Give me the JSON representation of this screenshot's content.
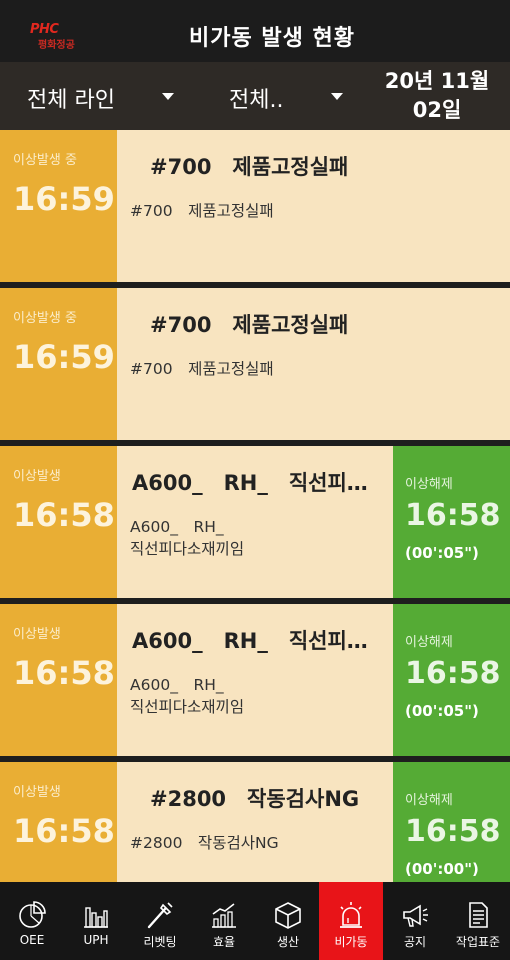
{
  "header": {
    "logo_mark": "PHC",
    "logo_text": "평화정공",
    "title": "비가동 발생 현황"
  },
  "filters": {
    "line": "전체 라인",
    "type": "전체..",
    "date_line1": "20년 11월",
    "date_line2": "02일"
  },
  "cards": [
    {
      "status": "이상발생 중",
      "time": "16:59",
      "title": "#700　제품고정실패",
      "desc": "#700　제품고정실패",
      "resolved": false
    },
    {
      "status": "이상발생 중",
      "time": "16:59",
      "title": "#700　제품고정실패",
      "desc": "#700　제품고정실패",
      "resolved": false
    },
    {
      "status": "이상발생",
      "time": "16:58",
      "title": "A600_　RH_　직선피…",
      "desc": "A600_　RH_\n직선피다소재끼임",
      "resolved": true,
      "resolved_status": "이상해제",
      "resolved_time": "16:58",
      "duration": "(00':05\")"
    },
    {
      "status": "이상발생",
      "time": "16:58",
      "title": "A600_　RH_　직선피…",
      "desc": "A600_　RH_\n직선피다소재끼임",
      "resolved": true,
      "resolved_status": "이상해제",
      "resolved_time": "16:58",
      "duration": "(00':05\")"
    },
    {
      "status": "이상발생",
      "time": "16:58",
      "title": "#2800　작동검사NG",
      "desc": "#2800　작동검사NG",
      "resolved": true,
      "resolved_status": "이상해제",
      "resolved_time": "16:58",
      "duration": "(00':00\")"
    }
  ],
  "nav": [
    {
      "label": "OEE",
      "icon": "pie-chart-icon",
      "active": false
    },
    {
      "label": "UPH",
      "icon": "bar-chart-icon",
      "active": false
    },
    {
      "label": "리벳팅",
      "icon": "rivet-tool-icon",
      "active": false
    },
    {
      "label": "효율",
      "icon": "trend-chart-icon",
      "active": false
    },
    {
      "label": "생산",
      "icon": "box-icon",
      "active": false
    },
    {
      "label": "비가동",
      "icon": "alarm-siren-icon",
      "active": true
    },
    {
      "label": "공지",
      "icon": "megaphone-icon",
      "active": false
    },
    {
      "label": "작업표준",
      "icon": "document-icon",
      "active": false
    }
  ],
  "colors": {
    "occurred": "#e9ae34",
    "resolved": "#55ab35",
    "card_body": "#f8e4c0",
    "active_nav": "#e81418"
  }
}
